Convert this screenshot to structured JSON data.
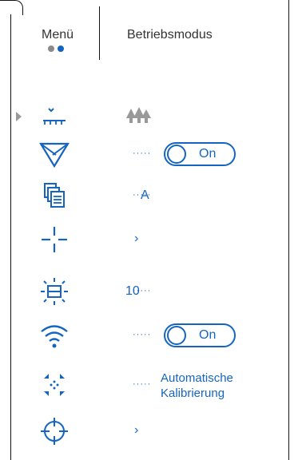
{
  "tabs": {
    "menu_label": "Menü",
    "mode_label": "Betriebsmodus",
    "page_dots": 2,
    "active_dot": 2
  },
  "items": {
    "scene": {
      "icon": "scene-terrain-icon",
      "value_icon": "forest-icon"
    },
    "stream": {
      "icon": "triangle-filter-icon",
      "state": "On"
    },
    "recording": {
      "icon": "file-copy-icon",
      "value": "A"
    },
    "crosshair": {
      "icon": "crosshair-icon"
    },
    "brightness": {
      "icon": "display-brightness-icon",
      "value": "10"
    },
    "wifi": {
      "icon": "wifi-icon",
      "state": "On"
    },
    "calibration": {
      "icon": "calibration-arrows-icon",
      "value": "Automatische Kalibrierung"
    },
    "target": {
      "icon": "target-icon"
    }
  },
  "colors": {
    "accent": "#1565c0",
    "text": "#333333"
  }
}
